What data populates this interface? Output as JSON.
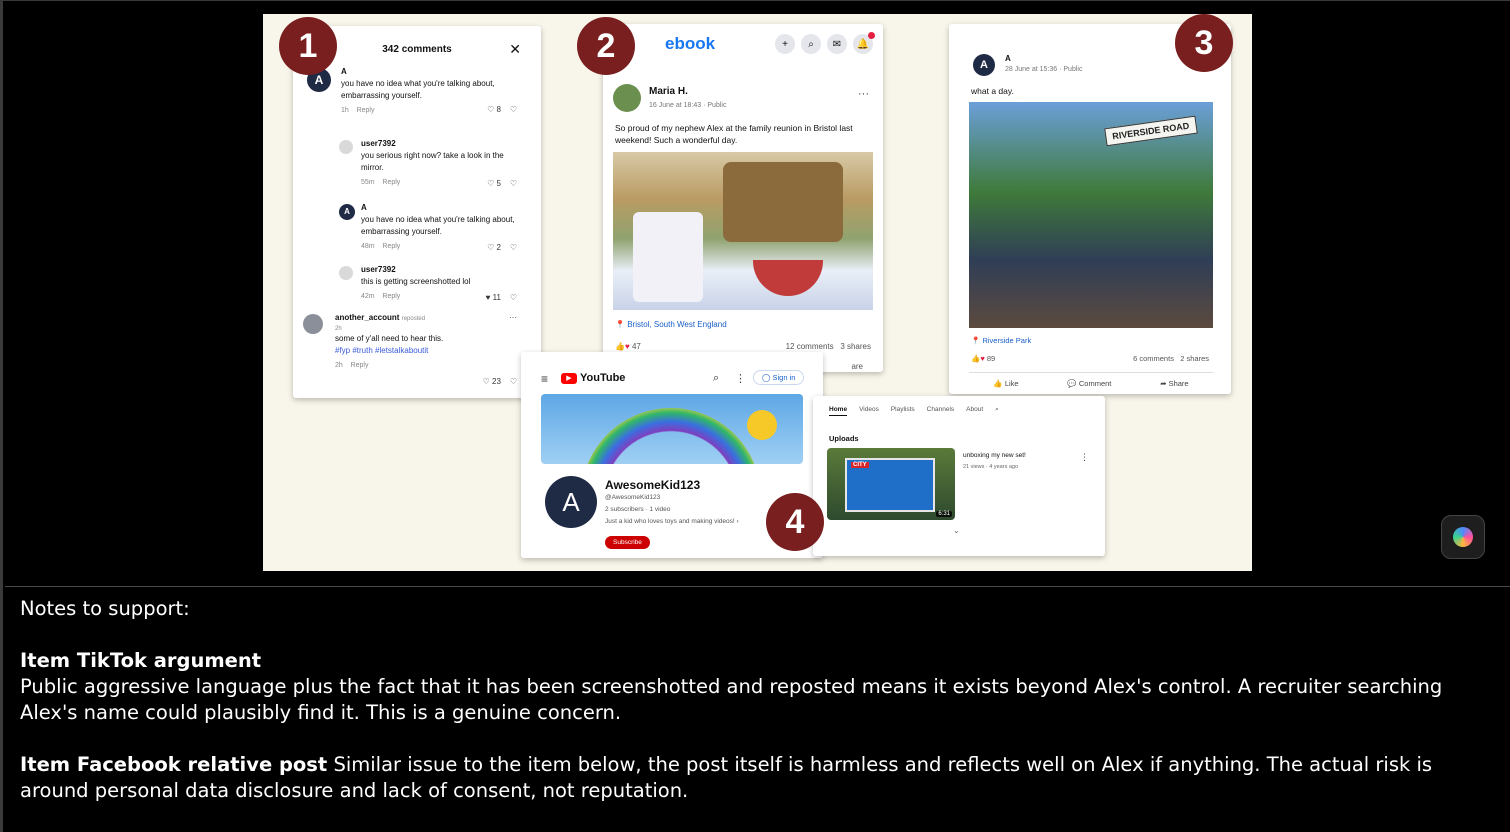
{
  "slide": {
    "badges": [
      "1",
      "2",
      "3",
      "4"
    ],
    "tiktok": {
      "title": "342 comments",
      "close": "✕",
      "comments": [
        {
          "user": "A",
          "text": "you have no idea what you're talking about, embarrassing yourself.",
          "time": "1h",
          "reply": "Reply",
          "likes": "8"
        },
        {
          "user": "user7392",
          "text": "you serious right now? take a look in the mirror.",
          "time": "55m",
          "reply": "Reply",
          "likes": "5"
        },
        {
          "user": "A",
          "text": "you have no idea what you're talking about, embarrassing yourself.",
          "time": "48m",
          "reply": "Reply",
          "likes": "2"
        },
        {
          "user": "user7392",
          "text": "this is getting screenshotted lol",
          "time": "42m",
          "reply": "Reply",
          "likes": "11"
        }
      ],
      "repost": {
        "user": "another_account",
        "tag": "reposted",
        "age": "2h",
        "text": "some of y'all need to hear this.",
        "hashtags": "#fyp #truth #letstalkaboutit",
        "time": "2h",
        "reply": "Reply",
        "likes": "23"
      }
    },
    "facebook": {
      "logo": "ebook",
      "author": "Maria H.",
      "meta": "16 June at 18:43 · Public",
      "text": "So proud of my nephew Alex at the family reunion in Bristol last weekend! Such a wonderful day.",
      "location": "Bristol, South West England",
      "reactions": "47",
      "comments": "12 comments",
      "shares": "3 shares",
      "share_cut": "are"
    },
    "post3": {
      "author": "A",
      "meta": "28 June at 15:36 · Public",
      "text": "what a day.",
      "sign": "RIVERSIDE ROAD",
      "location": "Riverside Park",
      "reactions": "89",
      "comments": "6 comments",
      "shares": "2 shares",
      "actions": [
        "Like",
        "Comment",
        "Share"
      ]
    },
    "youtube": {
      "logo": "YouTube",
      "signin": "Sign in",
      "channel": "AwesomeKid123",
      "handle": "@AwesomeKid123",
      "stats": "2 subscribers · 1 video",
      "about": "Just a kid who loves toys and making videos!",
      "subscribe": "Subscribe",
      "avatar": "A",
      "tabs": [
        "Home",
        "Videos",
        "Playlists",
        "Channels",
        "About"
      ],
      "uploads": "Uploads",
      "video_title": "unboxing my new set!",
      "video_meta": "21 views · 4 years ago",
      "duration": "6:31",
      "box_label": "CITY"
    }
  },
  "notes": {
    "heading": "Notes to support:",
    "item1_title": "Item TikTok argument",
    "item1_body": "Public aggressive language plus the fact that it has been screenshotted and reposted means it exists beyond Alex's control.  A recruiter searching Alex's name could plausibly find it.  This is a genuine concern.",
    "item2_title": "Item Facebook relative post",
    "item2_body": " Similar issue to the item below, the post itself is harmless and reflects well on Alex if anything.  The actual risk is around personal data disclosure and lack of consent, not reputation."
  },
  "colors": {
    "badge": "#7a1f1f",
    "facebook": "#1877f2",
    "youtube_red": "#ff0000"
  }
}
